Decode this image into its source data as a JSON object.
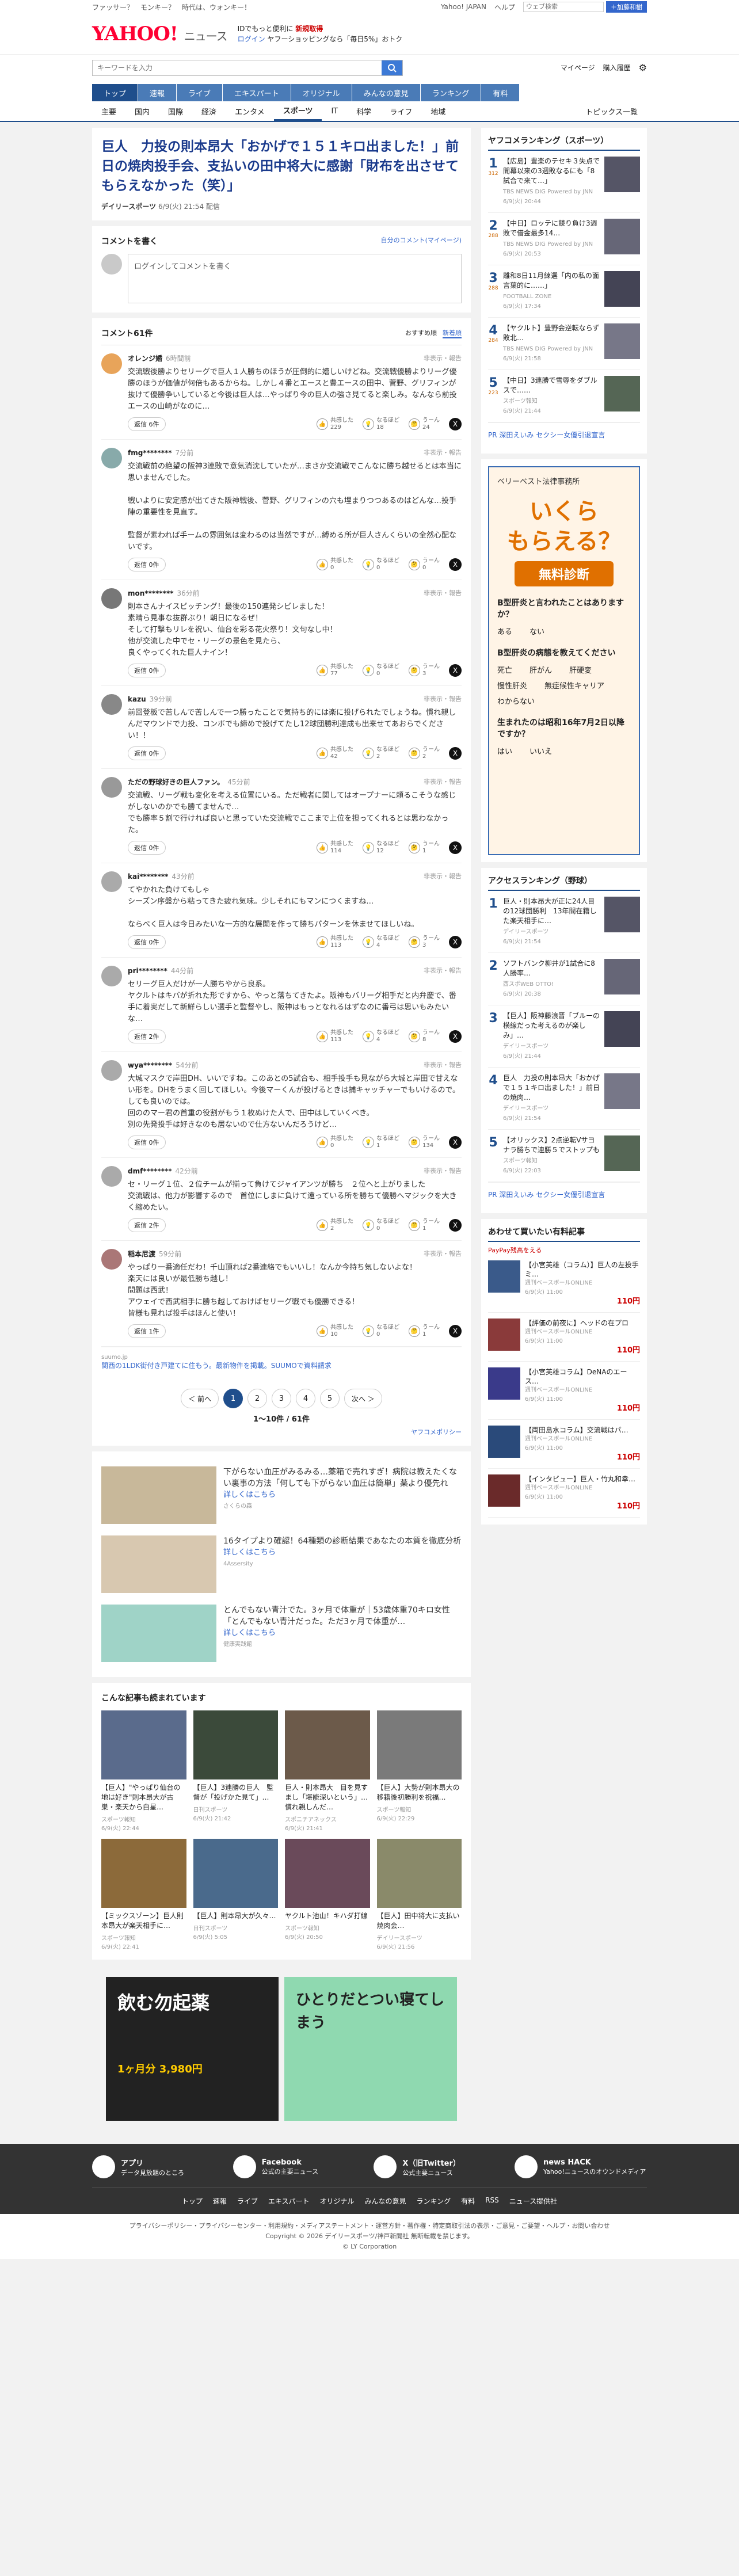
{
  "topstrip": {
    "left": "ファッサー？　モンキー？　時代は、ウォンキー！",
    "right": [
      "Yahoo! JAPAN",
      "ヘルプ"
    ],
    "search_placeholder": "ウェブ検索",
    "search_btn": "＋加藤和樹"
  },
  "brand": {
    "logo": "YAHOO!",
    "sub": "ニュース",
    "promo_line1": "IDでもっと便利に",
    "promo_line1b": "新規取得",
    "promo_line2": "ログイン",
    "promo_line3": "ヤフーショッピングなら「毎日5%」おトク"
  },
  "search": {
    "placeholder": "キーワードを入力",
    "right": [
      "マイページ",
      "購入履歴"
    ]
  },
  "gnav": [
    "トップ",
    "速報",
    "ライブ",
    "エキスパート",
    "オリジナル",
    "みんなの意見",
    "ランキング",
    "有料"
  ],
  "snav": [
    "主要",
    "国内",
    "国際",
    "経済",
    "エンタメ",
    "スポーツ",
    "IT",
    "科学",
    "ライフ",
    "地域"
  ],
  "snav_right": "トピックス一覧",
  "article": {
    "title": "巨人　力投の則本昂大「おかげで１５１キロ出ました！」前日の焼肉投手会、支払いの田中将大に感謝「財布を出させてもらえなかった（笑）」",
    "source": "デイリースポーツ",
    "date": "6/9(火) 21:54 配信"
  },
  "comment_form": {
    "heading": "コメントを書く",
    "mylink": "自分のコメント(マイページ)",
    "placeholder": "ログインしてコメントを書く"
  },
  "comments_head": {
    "label": "コメント61件",
    "sort": [
      "おすすめ順",
      "新着順"
    ]
  },
  "labels": {
    "report": "非表示・報告",
    "reply": "返信",
    "agree": "共感した",
    "think": "なるほど",
    "hmm": "うーん"
  },
  "comments": [
    {
      "name": "オレンジ婚",
      "time": "6時間前",
      "text": "交流戦後勝よりセリーグで巨人１人勝ちのほうが圧倒的に嬉しいけどね。交流戦優勝よりリーグ優勝のほうが価値が何倍もあるからね。しかし４番とエースと豊エースの田中、菅野、グリフィンが抜けて優勝争いしていると今後は巨人は…やっぱり今の巨人の強さ見てると楽しみ。なんなら前投エースの山崎がなのに…",
      "replies": "返信 6件",
      "agree": "229",
      "think": "18",
      "hmm": "24",
      "color": "#e8a45a"
    },
    {
      "name": "fmg********",
      "time": "7分前",
      "text": "交流戦前の絶望の阪神3連敗で意気消沈していたが…まさか交流戦でこんなに勝ち越せるとは本当に思いませんでした。\n\n戦いよりに安定感が出てきた阪神戦後、菅野、グリフィンの穴も埋まりつつあるのはどんな…投手陣の重要性を見直す。\n\n監督が素われば手ームの雰囲気は変わるのは当然ですが…縛める所が巨人さんくらいの全然心配ないです。",
      "replies": "返信 0件",
      "agree": "0",
      "think": "0",
      "hmm": "0",
      "color": "#8aa"
    },
    {
      "name": "mon********",
      "time": "36分前",
      "text": "則本さんナイスピッチング！最後の150連発シビレました！\n素晴ら見事な抜群ぶり！朝日になるぜ！\nそして打撃もリレを祝い、仙台を彩る花火祭り！文句なし中！\n他が交流した中でセ・リーグの景色を見たら、\n良くやってくれた巨人ナイン！",
      "replies": "返信 0件",
      "agree": "77",
      "think": "0",
      "hmm": "3",
      "color": "#777"
    },
    {
      "name": "kazu",
      "time": "39分前",
      "text": "前回登板で苦しんで苦しんで一つ勝ったことで気持ち的には楽に投げられたでしょうね。慣れ親しんだマウンドで力投、コンボでも締めで投げてたし12球団勝利達成も出来せてあおらでください！！",
      "replies": "返信 0件",
      "agree": "42",
      "think": "2",
      "hmm": "2",
      "color": "#888"
    },
    {
      "name": "ただの野球好きの巨人ファン。",
      "time": "45分前",
      "text": "交流戦、リーグ戦も変化を考える位置にいる。ただ戦者に関してはオープナーに頼るこそうな感じがしないのかでも勝てませんで…\nでも勝率５割で行ければ良いと思っていた交流戦でここまで上位を担ってくれるとは思わなかった。",
      "replies": "返信 0件",
      "agree": "114",
      "think": "12",
      "hmm": "1",
      "color": "#999"
    },
    {
      "name": "kai********",
      "time": "43分前",
      "text": "てやかれた負けてもしゃ\nシーズン序盤から粘ってきた疲れ気味。少しそれにもマンにつくますね…\n\nならべく巨人は今日みたいな一方的な展開を作って勝ちパターンを休ませてほしいね。",
      "replies": "返信 0件",
      "agree": "113",
      "think": "4",
      "hmm": "3",
      "color": "#aaa"
    },
    {
      "name": "pri********",
      "time": "44分前",
      "text": "セリーグ巨人だけが一人勝ちやから良系。\nヤクルトはキバが折れた形ですから、やっと落ちてきたよ。阪神もバリーグ相手だと内弁慶で、番手に着実だして新鮮らしい選手と監督やし、阪神はもっとなれるはずなのに番弓は思いもみたいな…",
      "replies": "返信 2件",
      "agree": "113",
      "think": "4",
      "hmm": "8",
      "color": "#aaa"
    },
    {
      "name": "wya********",
      "time": "54分前",
      "text": "大城マスクで岸田DH、いいですね。このあとの5試合も、相手投手も見ながら大城と岸田で甘えない形を。DHをうまく回してほしい。今後マーくんが投げるときは捕キャッチャーでもいけるので。しても良いのでは。\n回ののマー君の首重の役割がもう１枚ぬけた人で、田中はしていくべき。\n別の先発投手は好きなのも居ないので仕方ないんだろうけど…",
      "replies": "返信 0件",
      "agree": "0",
      "think": "1",
      "hmm": "134",
      "color": "#aaa"
    },
    {
      "name": "dmf********",
      "time": "42分前",
      "text": "セ・リーグ１位、２位チームが揃って負けてジャイアンツが勝ち　２位へと上がりました\n交流戦は、他力が影響するので　首位にしまに負けて遠っている所を勝ちて優勝へマジックを大きく縮めたい。",
      "replies": "返信 2件",
      "agree": "2",
      "think": "0",
      "hmm": "1",
      "color": "#aaa"
    },
    {
      "name": "稲本尼渡",
      "time": "59分前",
      "text": "やっぱり一番適任だわ！千山頂れば2番連絡でもいいし！なんか今持ち気しないよな！\n楽天には良いが最低勝ち越し！\n問題は西武！\nアウェイで西武相手に勝ち越しておけばセリーグ戦でも優勝できる！\n皆様も見れば投手はほんと使い！",
      "replies": "返信 1件",
      "agree": "10",
      "think": "0",
      "hmm": "1",
      "color": "#a77"
    }
  ],
  "inline_ad": {
    "label": "suumo.jp",
    "text": "関西の1LDK街付き戸建てに住もう。最新物件を掲載。SUUMOで資料請求"
  },
  "pager": {
    "prev": "＜ 前へ",
    "pages": [
      "1",
      "2",
      "3",
      "4",
      "5"
    ],
    "next": "次へ ＞",
    "count": "1〜10件 / 61件"
  },
  "policy": "ヤフコメポリシー",
  "promos": [
    {
      "title": "下がらない血圧がみるみる…薬箱で売れすぎ！病院は教えたくない裏事の方法「何しても下がらない血圧は簡単」薬より優先れ",
      "link": "詳しくはこちら",
      "src": "さくらの森"
    },
    {
      "title": "16タイプより確認！64種類の診断結果であなたの本質を徹底分析",
      "link": "詳しくはこちら",
      "src": "4Assersity"
    },
    {
      "title": "とんでもない青汁でた。3ヶ月で体重が｜53歳体重70キロ女性「とんでもない青汁だった。ただ3ヶ月で体重が…",
      "link": "詳しくはこちら",
      "src": "健康実践館"
    }
  ],
  "also_read": {
    "heading": "こんな記事も読まれています",
    "items": [
      {
        "t": "【巨人】\"やっぱり仙台の地は好き\"則本昂大が古巣・楽天から白星…",
        "s": "スポーツ報知",
        "d": "6/9(火) 22:44"
      },
      {
        "t": "【巨人】3連勝の巨人　監督が「投げかた見て」…",
        "s": "日刊スポーツ",
        "d": "6/9(火) 21:42"
      },
      {
        "t": "巨人・則本昂大　目を見すまし「堪能深いという」…慣れ親しんだ…",
        "s": "スポニチアネックス",
        "d": "6/9(火) 21:41"
      },
      {
        "t": "【巨人】大勢が則本昂大の移籍後初勝利を祝福…",
        "s": "スポーツ報知",
        "d": "6/9(火) 22:29"
      },
      {
        "t": "【ミックスゾーン】巨人則本昂大が楽天相手に…",
        "s": "スポーツ報知",
        "d": "6/9(火) 22:41"
      },
      {
        "t": "【巨人】則本昂大が久々…",
        "s": "日刊スポーツ",
        "d": "6/9(火) 5:05"
      },
      {
        "t": "ヤクルト池山！キハダ打線",
        "s": "スポーツ報知",
        "d": "6/9(火) 20:50"
      },
      {
        "t": "【巨人】田中将大に支払い焼肉会…",
        "s": "デイリースポーツ",
        "d": "6/9(火) 21:56"
      }
    ]
  },
  "ad_banners": [
    {
      "t": "飲む勿起薬",
      "p": "1ヶ月分 3,980円"
    },
    {
      "t": "ひとりだとつい寝てしまう"
    }
  ],
  "side": {
    "ranking_title": "ヤフコメランキング（スポーツ）",
    "ranking": [
      {
        "n": "1",
        "c": "312",
        "t": "【広島】豊楽のテセキ３失点で開幕以来の3週敗なるにも「8試合で来て…」",
        "s": "TBS NEWS DIG Powered by JNN",
        "d": "6/9(火) 20:44"
      },
      {
        "n": "2",
        "c": "288",
        "t": "【中日】ロッテに競り負け3週敗で借金最多14…",
        "s": "TBS NEWS DIG Powered by JNN",
        "d": "6/9(火) 20:53"
      },
      {
        "n": "3",
        "c": "288",
        "t": "離和8日11月練選「内の私の面言葉的に……」",
        "s": "FOOTBALL ZONE",
        "d": "6/9(火) 17:34"
      },
      {
        "n": "4",
        "c": "284",
        "t": "【ヤクルト】豊野会逆転ならず敗北…",
        "s": "TBS NEWS DIG Powered by JNN",
        "d": "6/9(火) 21:58"
      },
      {
        "n": "5",
        "c": "223",
        "t": "【中日】3連勝で雪辱をダブルスで……",
        "s": "スポーツ報知",
        "d": "6/9(火) 21:44"
      }
    ],
    "pr": "PR 深田えいみ セクシー女優引退宣言",
    "access_title": "アクセスランキング（野球）",
    "access": [
      {
        "n": "1",
        "t": "巨人・則本昂大が正に24人目の12球団勝利　13年間在籍した楽天相手に…",
        "s": "デイリースポーツ",
        "d": "6/9(火) 21:54"
      },
      {
        "n": "2",
        "t": "ソフトバンク柳井が1試合に8人勝率…",
        "s": "西スポWEB OTTO!",
        "d": "6/9(火) 20:38"
      },
      {
        "n": "3",
        "t": "【巨人】阪神藤浪晋「ブルーの横線だった考えるのが楽しみ」…",
        "s": "デイリースポーツ",
        "d": "6/9(火) 21:44"
      },
      {
        "n": "4",
        "t": "巨人　力投の則本昂大「おかげで１５１キロ出ました！」前日の焼肉…",
        "s": "デイリースポーツ",
        "d": "6/9(火) 21:54"
      },
      {
        "n": "5",
        "t": "【オリックス】2点逆転Vサヨナラ勝ちで連勝５でストップも",
        "s": "スポーツ報知",
        "d": "6/9(火) 22:03"
      }
    ],
    "pr2": "PR 深田えいみ セクシー女優引退宣言",
    "shop_title": "あわせて買いたい有料記事",
    "shop_brand": "PayPay残高をえる",
    "shop": [
      {
        "t": "【小宮英雄（コラム）】巨人の左投手ミ…",
        "s": "週刊ベースボールONLINE",
        "d": "6/9(火) 11:00",
        "p": "110円"
      },
      {
        "t": "【評価の前夜に】ヘッドの在プロ",
        "s": "週刊ベースボールONLINE",
        "d": "6/9(火) 11:00",
        "p": "110円"
      },
      {
        "t": "【小宮英雄コラム】DeNAのエース…",
        "s": "週刊ベースボールONLINE",
        "d": "6/9(火) 11:00",
        "p": "110円"
      },
      {
        "t": "【両田島水コラム】交流戦はパ…",
        "s": "週刊ベースボールONLINE",
        "d": "6/9(火) 11:00",
        "p": "110円"
      },
      {
        "t": "【インタビュー】巨人・竹丸和幸…",
        "s": "週刊ベースボールONLINE",
        "d": "6/9(火) 11:00",
        "p": "110円"
      }
    ],
    "bigad": {
      "h": "ベリーベスト法律事務所",
      "l1": "いくら",
      "l2": "もらえる？",
      "free": "無料診断",
      "q1": "B型肝炎と言われたことはありますか？",
      "o1": [
        "ある",
        "ない"
      ],
      "q2": "B型肝炎の病態を教えてください",
      "o2": [
        "死亡",
        "肝がん",
        "肝硬変",
        "慢性肝炎",
        "無症候性キャリア",
        "わからない"
      ],
      "q3": "生まれたのは昭和16年7月2日以降ですか？",
      "o3": [
        "はい",
        "いいえ"
      ]
    }
  },
  "footer": {
    "apps": [
      {
        "b": "アプリ",
        "t": "データ見放題のところ"
      },
      {
        "b": "Facebook",
        "t": "公式の主要ニュース"
      },
      {
        "b": "X（旧Twitter）",
        "t": "公式主要ニュース"
      },
      {
        "b": "news HACK",
        "t": "Yahoo!ニュースのオウンドメディア"
      }
    ],
    "nav": [
      "トップ",
      "速報",
      "ライブ",
      "エキスパート",
      "オリジナル",
      "みんなの意見",
      "ランキング",
      "有料",
      "RSS",
      "ニュース提供社"
    ],
    "links": "プライバシーポリシー・プライバシーセンター・利用規約・メディアステートメント・運営方針・著作権・特定商取引法の表示・ご意見・ご要望・ヘルプ・お問い合わせ",
    "copy": "Copyright © 2026 デイリースポーツ/神戸新聞社 無断転載を禁じます。",
    "copy2": "© LY Corporation"
  }
}
